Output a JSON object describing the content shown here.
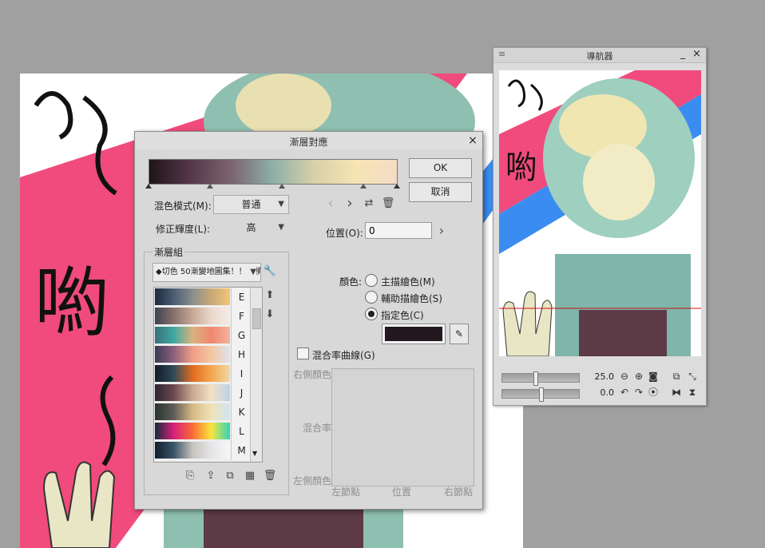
{
  "navigator": {
    "title": "導航器",
    "minimize_glyph": "_",
    "close_glyph": "×",
    "menu_glyph": "≡",
    "zoom_value": "25.0",
    "rotation_value": "0.0",
    "zoom_level": 0.42,
    "rotation_level": 0.5
  },
  "canvas": {
    "hand_text": "喲"
  },
  "dialog": {
    "title": "漸層對應",
    "close_glyph": "×",
    "ok_label": "OK",
    "cancel_label": "取消",
    "blend_mode_label": "混色模式(M):",
    "blend_mode_value": "普通",
    "luminance_label": "修正輝度(L):",
    "luminance_value": "高",
    "position_label": "位置(O):",
    "position_value": "0",
    "gradient_set_label": "漸層組",
    "gradient_set_value": "◆切色 50漸變地圖集！！（積",
    "presets": [
      {
        "letter": "E",
        "colors": [
          "#1d2a3c",
          "#4a5d73",
          "#8a8e8d",
          "#c8a876",
          "#f3c777"
        ]
      },
      {
        "letter": "F",
        "colors": [
          "#3c4450",
          "#86706b",
          "#c7a795",
          "#ead8cb",
          "#f5ece6"
        ]
      },
      {
        "letter": "G",
        "colors": [
          "#39707d",
          "#3fa8a0",
          "#d9b27e",
          "#f08770",
          "#f4b59b"
        ]
      },
      {
        "letter": "H",
        "colors": [
          "#3a3c57",
          "#8d5f7c",
          "#ef9d86",
          "#f3c7a0",
          "#dfe2ee"
        ]
      },
      {
        "letter": "I",
        "colors": [
          "#101c26",
          "#304a58",
          "#e16b22",
          "#f4a64d",
          "#f0d8a8"
        ]
      },
      {
        "letter": "J",
        "colors": [
          "#2d2430",
          "#6b4953",
          "#c9a88e",
          "#f1e1c5",
          "#bcd1ea"
        ]
      },
      {
        "letter": "K",
        "colors": [
          "#28332f",
          "#5e5c58",
          "#d8b983",
          "#eee2b8",
          "#d0e6f2"
        ]
      },
      {
        "letter": "L",
        "colors": [
          "#142a3a",
          "#d8207b",
          "#f96a38",
          "#f9e63c",
          "#2fd4b8"
        ]
      },
      {
        "letter": "M",
        "colors": [
          "#0f1f2d",
          "#3a5367",
          "#c7c3be",
          "#e5e5e7",
          "#f7f7f9"
        ]
      }
    ],
    "color_label": "顏色:",
    "radio_main": "主描繪色(M)",
    "radio_sub": "輔助描繪色(S)",
    "radio_specified": "指定色(C)",
    "specified_color": "#23181f",
    "blend_curve_label": "混合率曲線(G)",
    "curve_right_color": "右側顏色",
    "curve_blend_rate": "混合率",
    "curve_left_color": "左側顏色",
    "curve_left_node": "左節點",
    "curve_position": "位置",
    "curve_right_node": "右節點",
    "gradient_colors": [
      "#1f1419",
      "#553748",
      "#7c6570",
      "#8eb0a8",
      "#d8d0a8",
      "#f6e4b4",
      "#f4dcc4"
    ]
  }
}
